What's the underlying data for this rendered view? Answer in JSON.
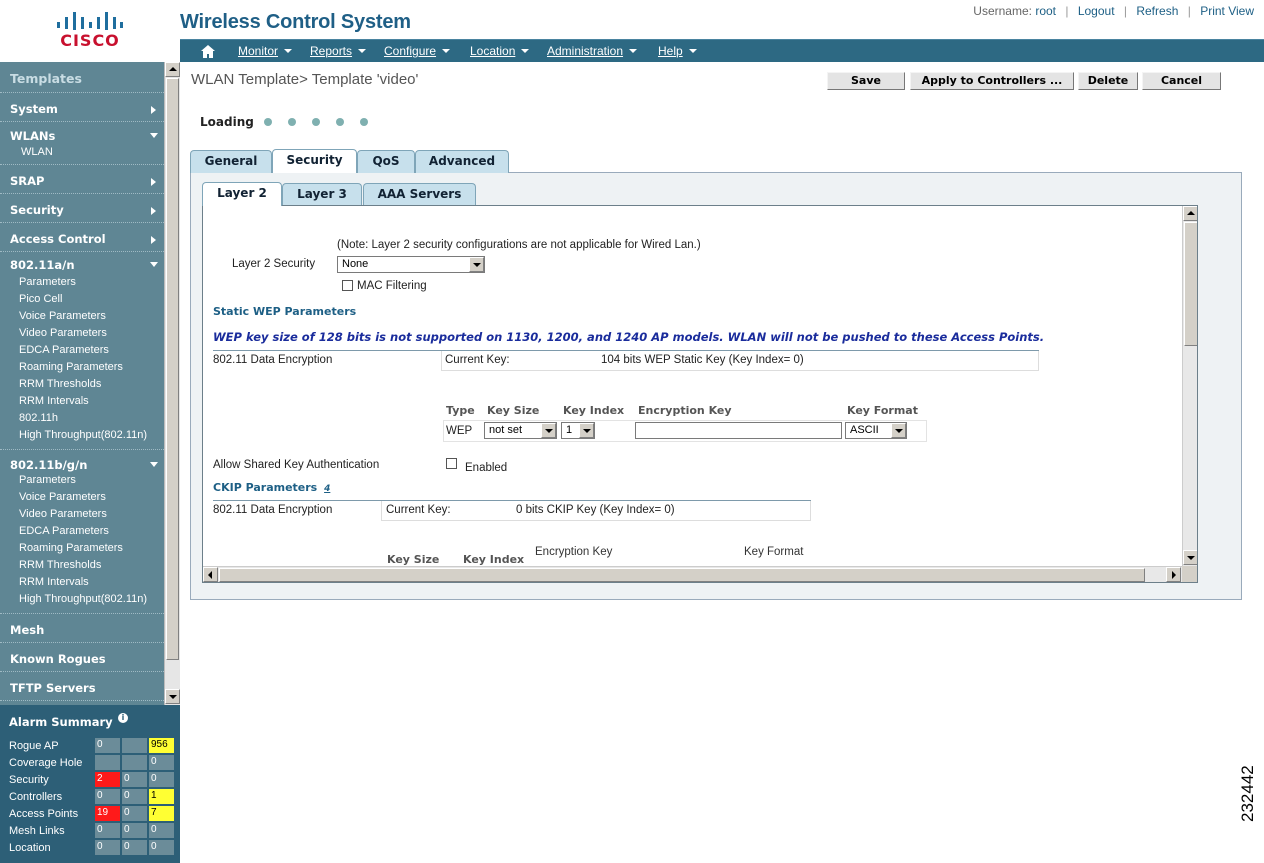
{
  "header": {
    "brand": "CISCO",
    "app_title": "Wireless Control System",
    "username_label": "Username:",
    "username": "root",
    "logout": "Logout",
    "refresh": "Refresh",
    "print_view": "Print View"
  },
  "nav": {
    "home_icon": "home-icon",
    "items": [
      "Monitor",
      "Reports",
      "Configure",
      "Location",
      "Administration",
      "Help"
    ]
  },
  "sidebar": {
    "title": "Templates",
    "system": "System",
    "wlans": "WLANs",
    "wlans_items": [
      "WLAN"
    ],
    "srap": "SRAP",
    "security": "Security",
    "access_control": "Access Control",
    "a_n": "802.11a/n",
    "a_n_items": [
      "Parameters",
      "Pico Cell",
      "Voice Parameters",
      "Video Parameters",
      "EDCA Parameters",
      "Roaming Parameters",
      "RRM Thresholds",
      "RRM Intervals",
      "802.11h",
      "High Throughput(802.11n)"
    ],
    "bgn": "802.11b/g/n",
    "bgn_items": [
      "Parameters",
      "Voice Parameters",
      "Video Parameters",
      "EDCA Parameters",
      "Roaming Parameters",
      "RRM Thresholds",
      "RRM Intervals",
      "High Throughput(802.11n)"
    ],
    "mesh": "Mesh",
    "known_rogues": "Known Rogues",
    "tftp_servers": "TFTP Servers"
  },
  "alarm_summary": {
    "title": "Alarm Summary",
    "info_icon": "info-icon",
    "rows": [
      {
        "label": "Rogue AP",
        "critical": "0",
        "major": "",
        "minor": "956"
      },
      {
        "label": "Coverage Hole",
        "critical": "",
        "major": "",
        "minor": "0"
      },
      {
        "label": "Security",
        "critical": "2",
        "major": "0",
        "minor": "0"
      },
      {
        "label": "Controllers",
        "critical": "0",
        "major": "0",
        "minor": "1"
      },
      {
        "label": "Access Points",
        "critical": "19",
        "major": "0",
        "minor": "7"
      },
      {
        "label": "Mesh Links",
        "critical": "0",
        "major": "0",
        "minor": "0"
      },
      {
        "label": "Location",
        "critical": "0",
        "major": "0",
        "minor": "0"
      }
    ],
    "colors": {
      "critical": "#ff1a1a",
      "minor": "#ffff33",
      "neutral": "#6b8c99"
    }
  },
  "main": {
    "title": "WLAN Template> Template 'video'",
    "buttons": {
      "save": "Save",
      "apply": "Apply to Controllers ...",
      "delete": "Delete",
      "cancel": "Cancel"
    },
    "loading": "Loading",
    "tabs": [
      "General",
      "Security",
      "QoS",
      "Advanced"
    ],
    "active_tab": "Security",
    "subtabs": [
      "Layer 2",
      "Layer 3",
      "AAA Servers"
    ],
    "active_subtab": "Layer 2",
    "layer2": {
      "note": "(Note: Layer 2 security configurations are not applicable for Wired Lan.)",
      "security_label": "Layer 2 Security",
      "security_value": "None",
      "mac_filtering": "MAC Filtering",
      "static_wep_title": "Static WEP Parameters",
      "wep_warning": "WEP key size of 128 bits is not supported on 1130, 1200, and 1240 AP models. WLAN will not be pushed to these Access Points.",
      "data_encryption_label": "802.11 Data Encryption",
      "current_key_label": "Current Key:",
      "wep_current_key": "104 bits WEP Static Key (Key Index= 0)",
      "wep_table": {
        "headers": [
          "Type",
          "Key Size",
          "Key Index",
          "Encryption Key",
          "Key Format"
        ],
        "type": "WEP",
        "key_size": "not set",
        "key_index": "1",
        "encryption_key": "",
        "key_format": "ASCII"
      },
      "shared_key_label": "Allow Shared Key Authentication",
      "enabled_label": "Enabled",
      "ckip_title": "CKIP Parameters",
      "ckip_footnote": "4",
      "ckip_current_key": "0 bits CKIP Key (Key Index= 0)",
      "ckip_headers": [
        "Key Size",
        "Key Index",
        "Encryption Key",
        "Key Format"
      ]
    }
  },
  "figure_number": "232442"
}
